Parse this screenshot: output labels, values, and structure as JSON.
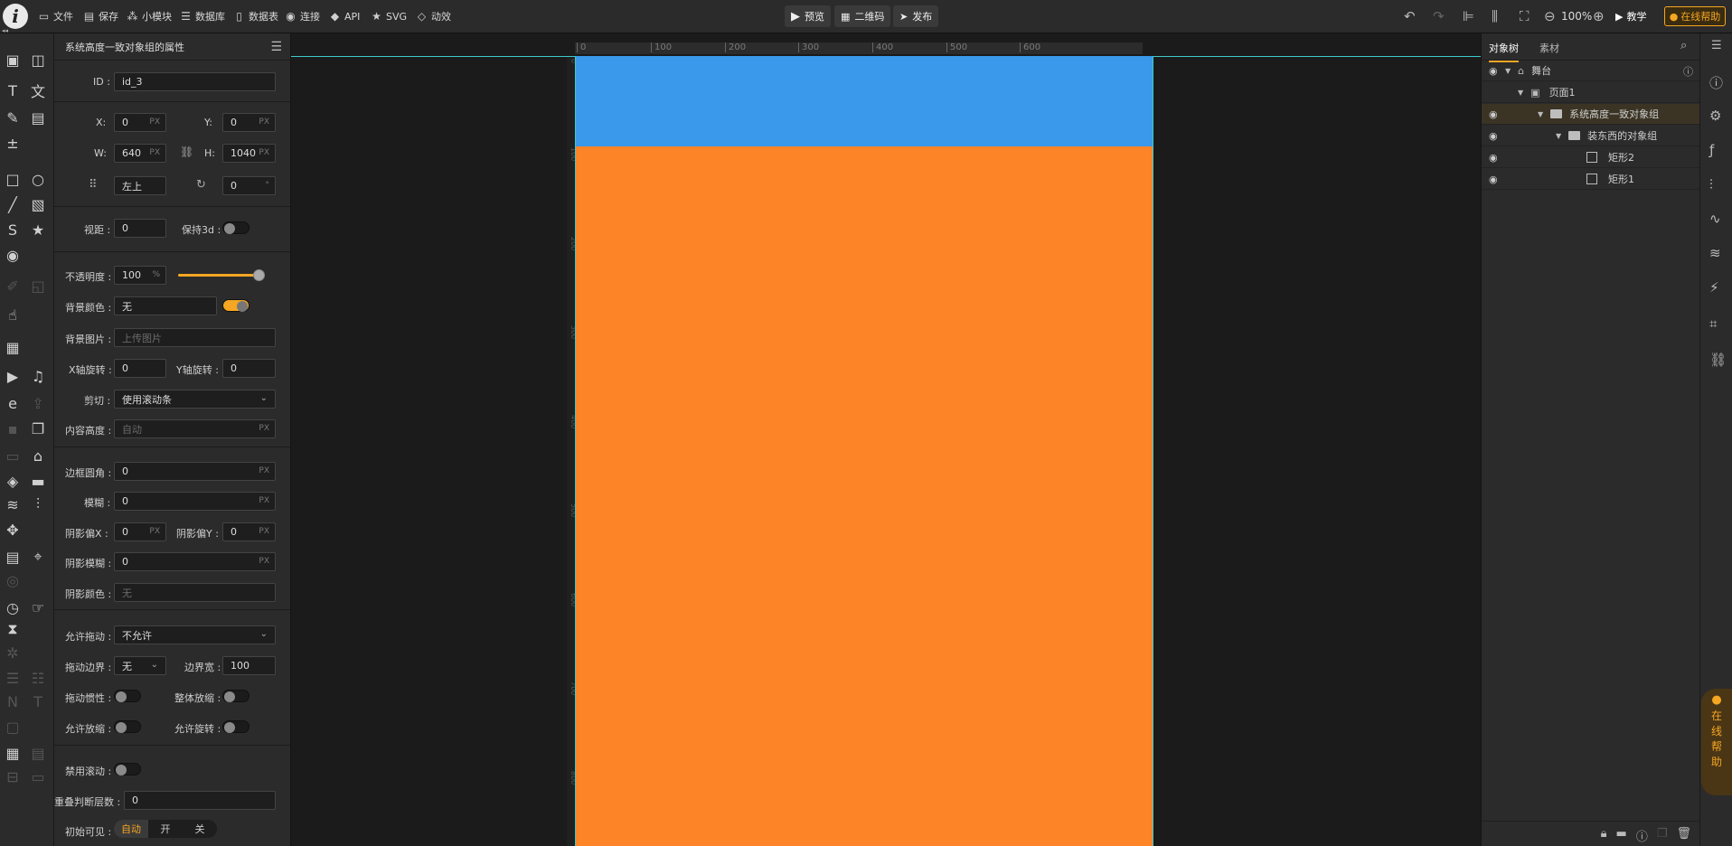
{
  "toolbar": {
    "items": [
      "文件",
      "保存",
      "小模块",
      "数据库",
      "数据表",
      "连接",
      "API",
      "SVG",
      "动效"
    ],
    "center_buttons": [
      "预览",
      "二维码",
      "发布"
    ],
    "zoom": "100%",
    "teach": "教学",
    "online_help": "在线帮助"
  },
  "props": {
    "title": "系统高度一致对象组的属性",
    "id_label": "ID :",
    "id_value": "id_3",
    "x_label": "X:",
    "x_value": "0",
    "y_label": "Y:",
    "y_value": "0",
    "w_label": "W:",
    "w_value": "640",
    "h_label": "H:",
    "h_value": "1040",
    "unit_px": "PX",
    "anchor_value": "左上",
    "rotation_value": "0",
    "rotation_unit": "°",
    "perspective_label": "视距 :",
    "perspective_value": "0",
    "keep3d_label": "保持3d :",
    "opacity_label": "不透明度 :",
    "opacity_value": "100",
    "opacity_unit": "%",
    "opacity_fraction": 1.0,
    "bgcolor_label": "背景颜色 :",
    "bgcolor_value": "无",
    "bgimage_label": "背景图片 :",
    "bgimage_placeholder": "上传图片",
    "xrot_label": "X轴旋转 :",
    "xrot_value": "0",
    "yrot_label": "Y轴旋转 :",
    "yrot_value": "0",
    "clip_label": "剪切 :",
    "clip_value": "使用滚动条",
    "content_height_label": "内容高度 :",
    "content_height_placeholder": "自动",
    "radius_label": "边框圆角 :",
    "radius_value": "0",
    "blur_label": "模糊 :",
    "blur_value": "0",
    "shadowx_label": "阴影偏X :",
    "shadowx_value": "0",
    "shadowy_label": "阴影偏Y :",
    "shadowy_value": "0",
    "shadowblur_label": "阴影模糊 :",
    "shadowblur_value": "0",
    "shadowcolor_label": "阴影颜色 :",
    "shadowcolor_value": "无",
    "drag_label": "允许拖动 :",
    "drag_value": "不允许",
    "dragbound_label": "拖动边界 :",
    "dragbound_value": "无",
    "boundwidth_label": "边界宽 :",
    "boundwidth_value": "100",
    "draginertia_label": "拖动惯性 :",
    "wholezoom_label": "整体放缩 :",
    "allowzoom_label": "允许放缩 :",
    "allowrotate_label": "允许旋转 :",
    "disablescroll_label": "禁用滚动 :",
    "overlap_label": "重叠判断层数 :",
    "overlap_value": "0",
    "initvisible_label": "初始可见 :",
    "initvisible_options": [
      "自动",
      "开",
      "关"
    ]
  },
  "ruler": {
    "h_ticks": [
      "0",
      "100",
      "200",
      "300",
      "400",
      "500",
      "600"
    ],
    "v_ticks": [
      "0",
      "100",
      "200",
      "300",
      "400",
      "500",
      "600",
      "700",
      "800"
    ]
  },
  "colors": {
    "blue_rect": "#3a99ea",
    "orange_rect": "#fd8528",
    "accent": "#f5a623",
    "guide": "#3fc9c9"
  },
  "tree": {
    "tabs": [
      "对象树",
      "素材"
    ],
    "rows": [
      {
        "label": "舞台"
      },
      {
        "label": "页面1"
      },
      {
        "label": "系统高度一致对象组"
      },
      {
        "label": "装东西的对象组"
      },
      {
        "label": "矩形2"
      },
      {
        "label": "矩形1"
      }
    ]
  },
  "float_help": [
    "在",
    "线",
    "帮",
    "助"
  ]
}
